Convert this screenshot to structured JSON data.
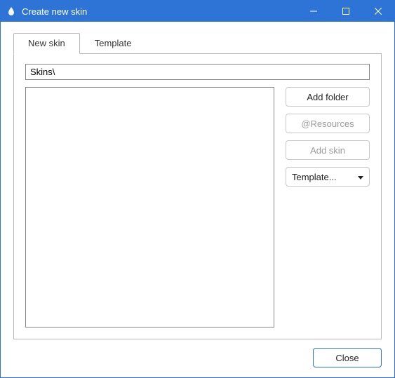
{
  "window": {
    "title": "Create new skin"
  },
  "tabs": {
    "new_skin": "New skin",
    "template": "Template"
  },
  "path": {
    "value": "Skins\\"
  },
  "buttons": {
    "add_folder": "Add folder",
    "resources": "@Resources",
    "add_skin": "Add skin",
    "template_dropdown": "Template...",
    "close": "Close"
  }
}
